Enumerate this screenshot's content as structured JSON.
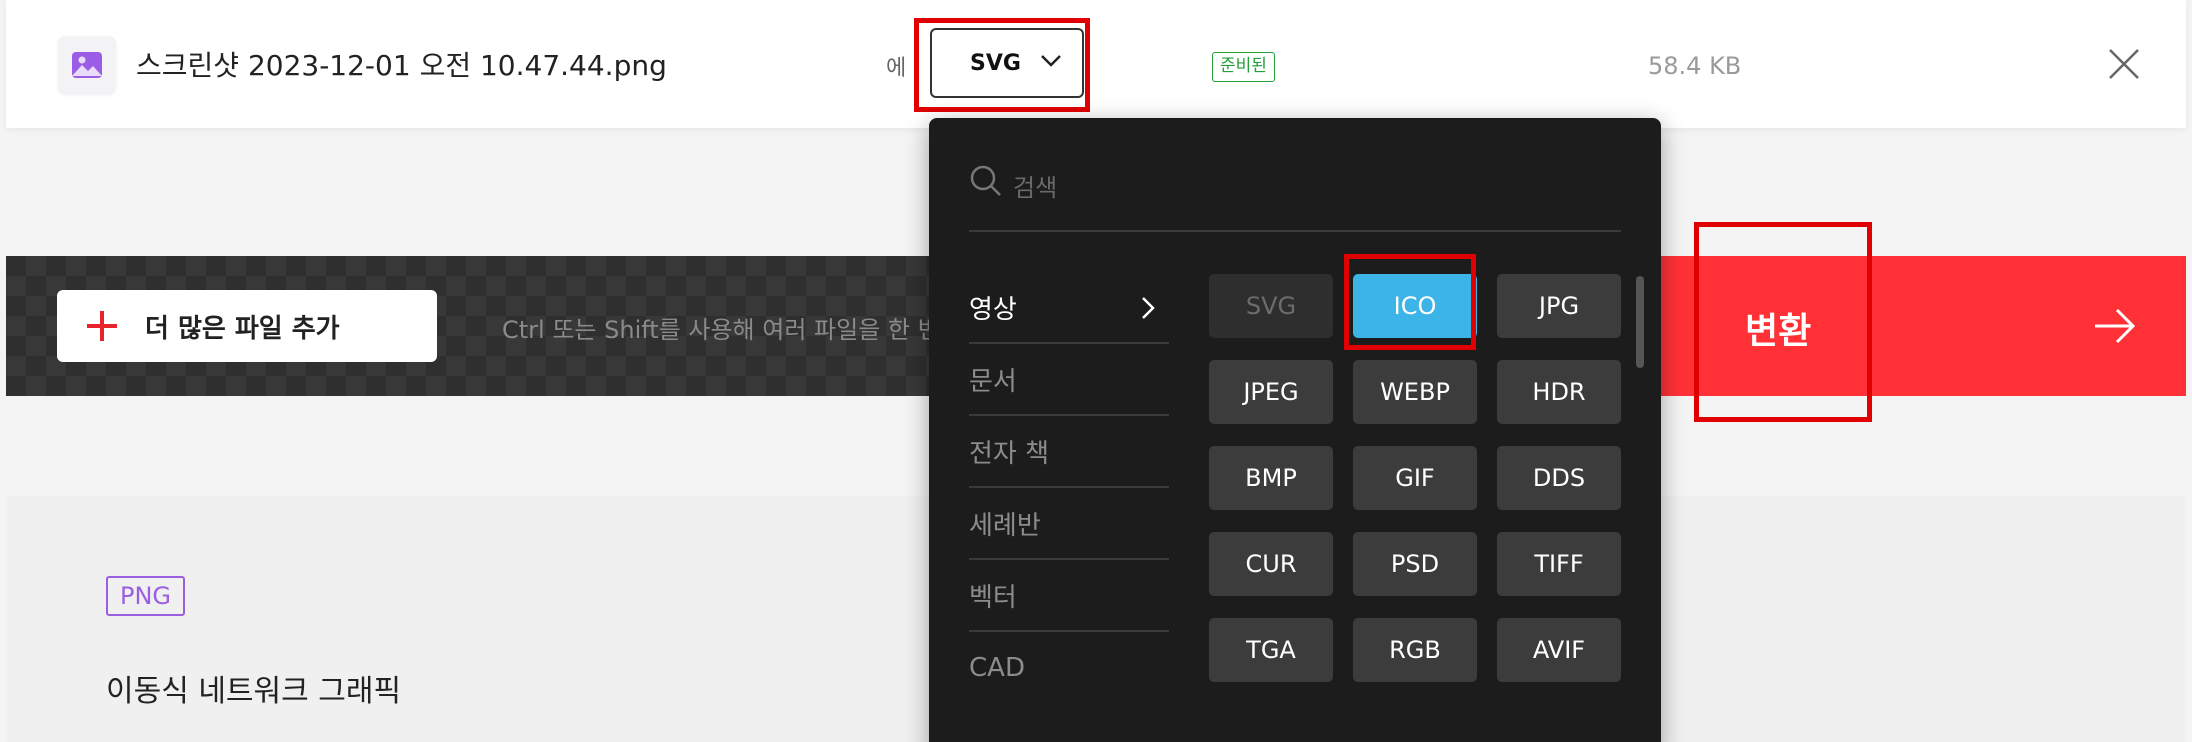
{
  "file": {
    "name": "스크린샷 2023-12-01 오전 10.47.44.png",
    "to_label": "에",
    "target_format": "SVG",
    "status": "준비된",
    "size": "58.4 KB"
  },
  "actions": {
    "add_more_label": "더 많은 파일 추가",
    "hint": "Ctrl 또는 Shift를 사용해 여러 파일을 한 번",
    "convert_label": "변환"
  },
  "info": {
    "type_badge": "PNG",
    "type_description": "이동식 네트워크 그래픽"
  },
  "dropdown": {
    "search_placeholder": "검색",
    "categories": [
      "영상",
      "문서",
      "전자 책",
      "세례반",
      "벡터",
      "CAD"
    ],
    "formats": [
      "SVG",
      "ICO",
      "JPG",
      "JPEG",
      "WEBP",
      "HDR",
      "BMP",
      "GIF",
      "DDS",
      "CUR",
      "PSD",
      "TIFF",
      "TGA",
      "RGB",
      "AVIF"
    ],
    "disabled_format": "SVG",
    "selected_format": "ICO"
  },
  "colors": {
    "accent_red": "#ff3136",
    "selected_blue": "#3cb4e8",
    "ready_green": "#22a13a",
    "png_purple": "#9a5fe0",
    "highlight_red": "#e00000"
  },
  "icons": {
    "file": "image-file-icon",
    "dropdown": "chevron-down-icon",
    "close": "close-icon",
    "add": "plus-icon",
    "convert": "arrow-right-icon",
    "search": "search-icon",
    "category": "chevron-right-icon"
  }
}
